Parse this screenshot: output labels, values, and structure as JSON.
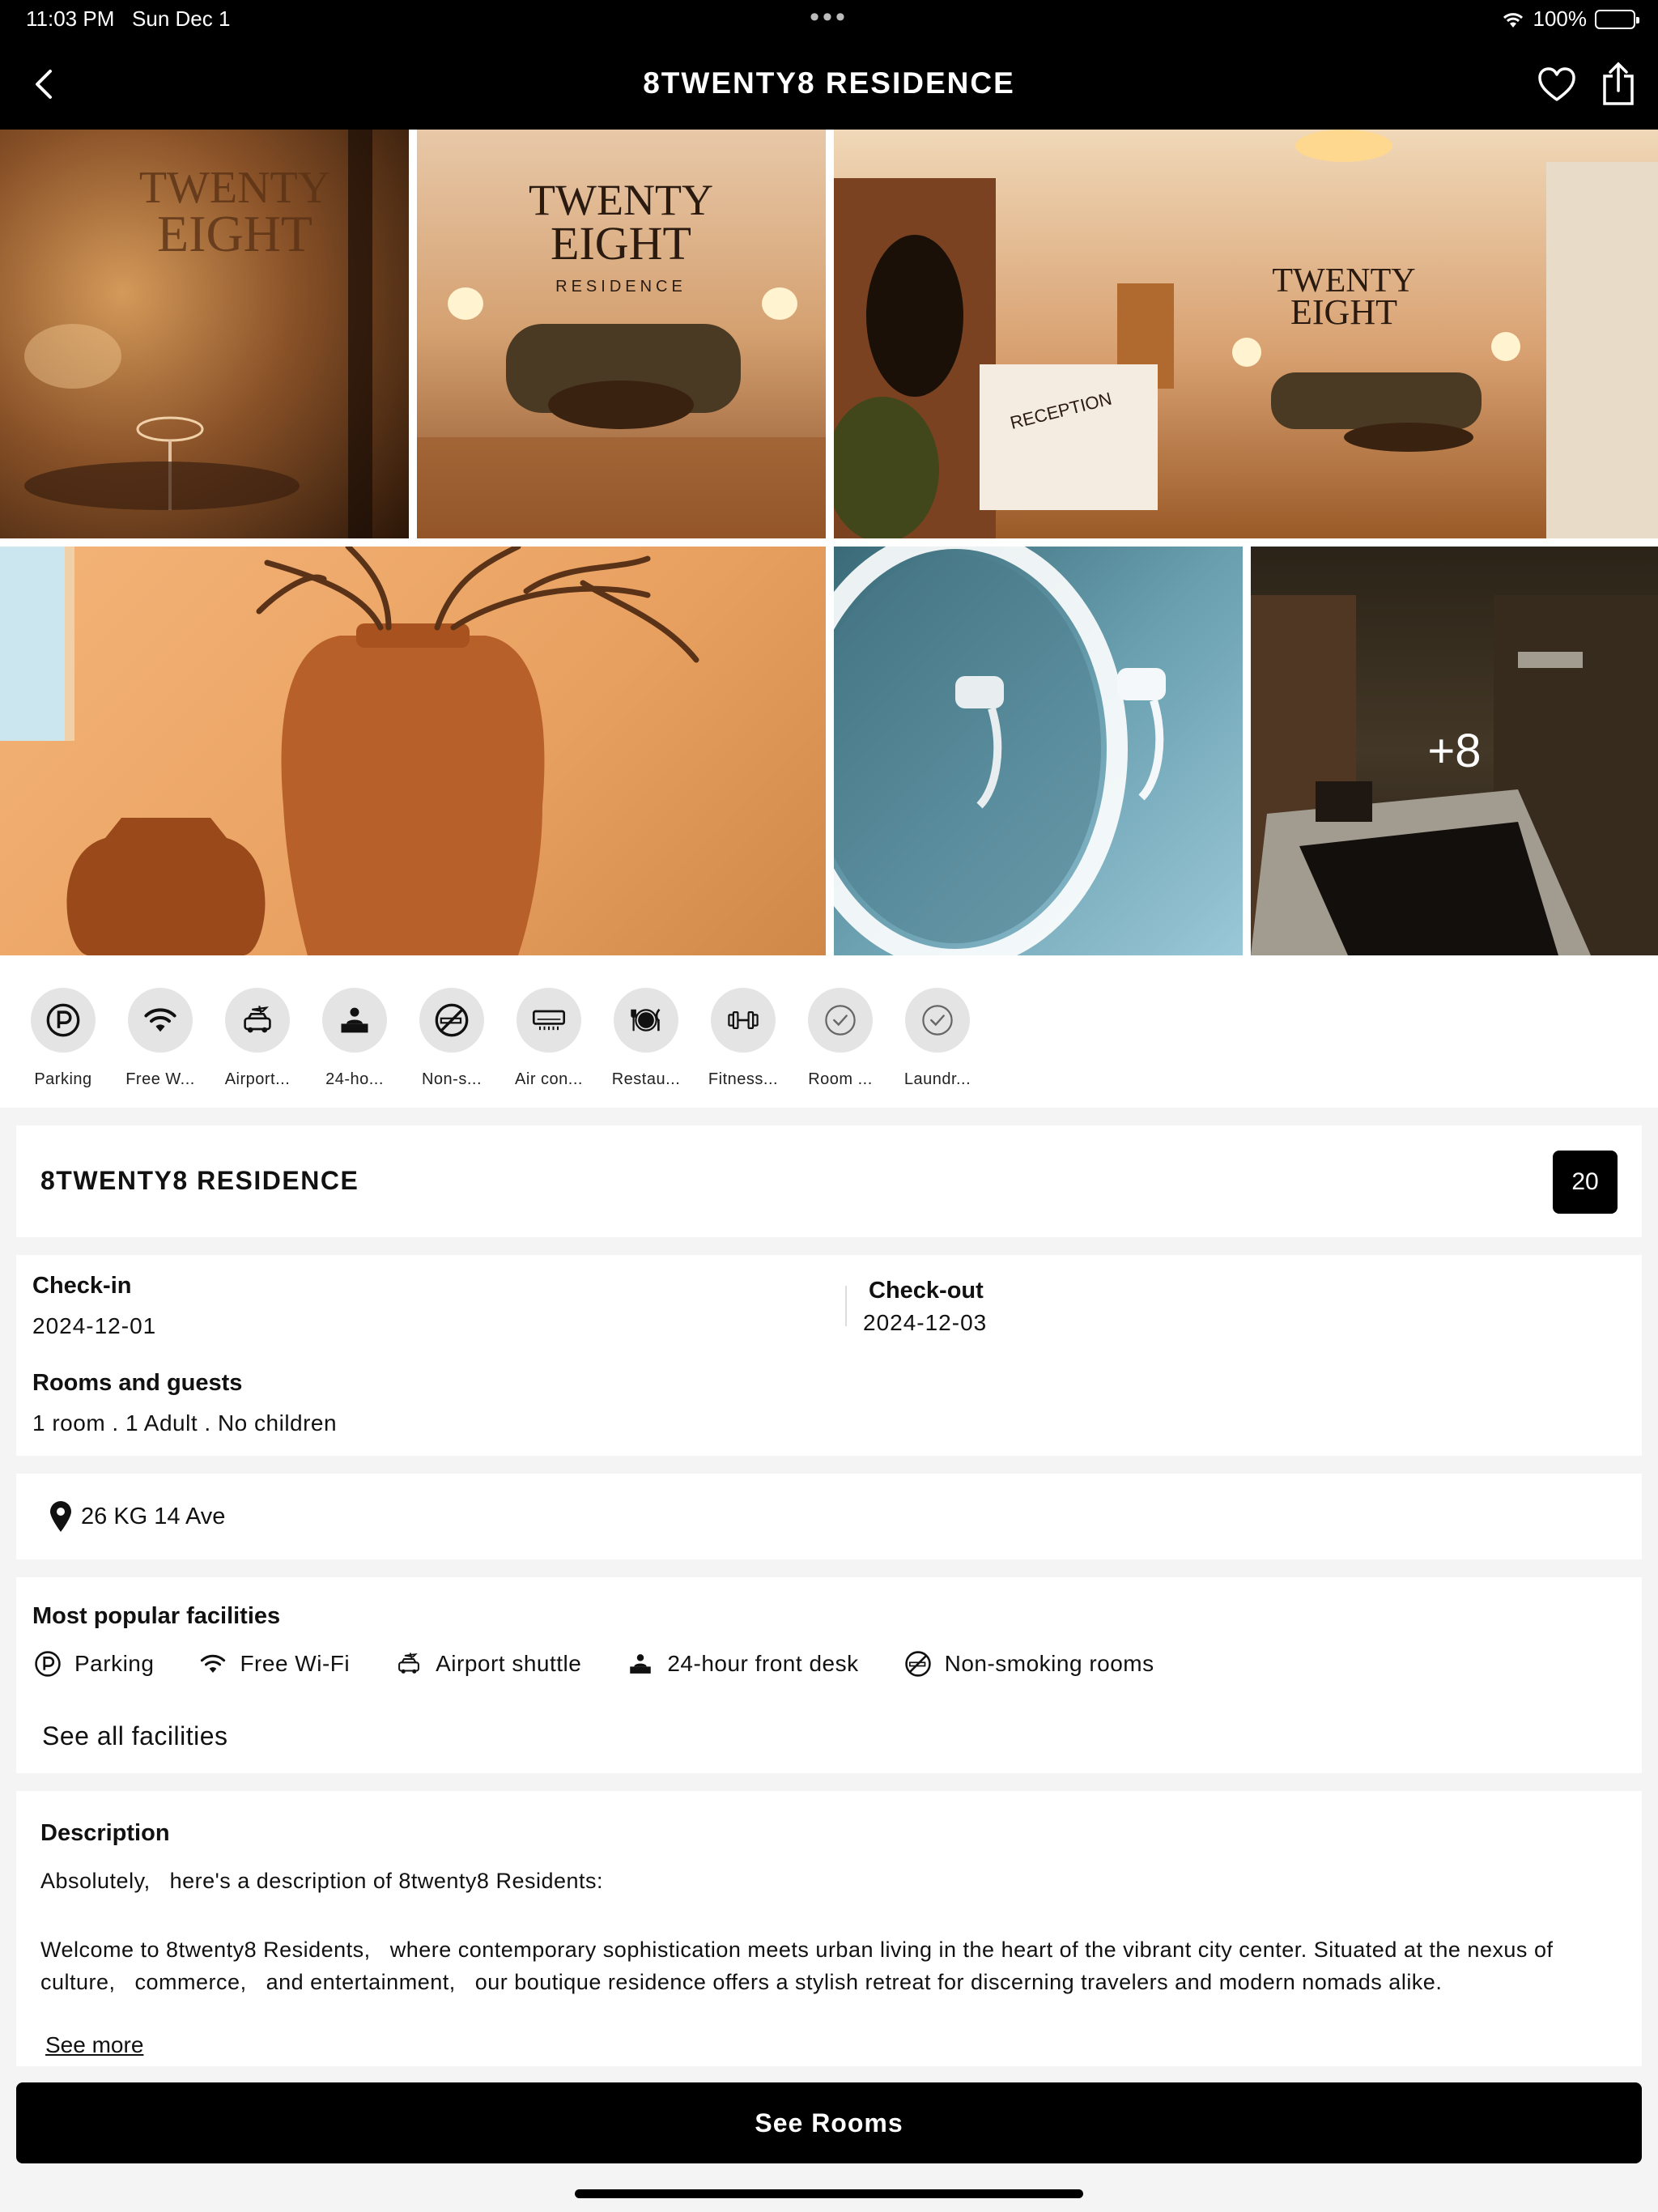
{
  "status": {
    "time": "11:03 PM",
    "date": "Sun Dec 1",
    "battery": "100%"
  },
  "nav": {
    "title": "8TWENTY8 RESIDENCE"
  },
  "gallery": {
    "more_label": "+8"
  },
  "icon_strip": [
    {
      "label": "Parking",
      "icon": "parking-icon"
    },
    {
      "label": "Free W...",
      "icon": "wifi-icon"
    },
    {
      "label": "Airport...",
      "icon": "shuttle-icon"
    },
    {
      "label": "24-ho...",
      "icon": "front-desk-icon"
    },
    {
      "label": "Non-s...",
      "icon": "no-smoking-icon"
    },
    {
      "label": "Air con...",
      "icon": "air-conditioner-icon"
    },
    {
      "label": "Restau...",
      "icon": "restaurant-icon"
    },
    {
      "label": "Fitness...",
      "icon": "dumbbell-icon"
    },
    {
      "label": "Room ...",
      "icon": "check-circle-icon"
    },
    {
      "label": "Laundr...",
      "icon": "check-circle-icon"
    }
  ],
  "hotel": {
    "name": "8TWENTY8 RESIDENCE",
    "score": "20"
  },
  "booking": {
    "checkin_label": "Check-in",
    "checkin_value": "2024-12-01",
    "checkout_label": "Check-out",
    "checkout_value": "2024-12-03",
    "rooms_label": "Rooms and guests",
    "rooms_value": "1 room . 1 Adult . No children"
  },
  "address": "26 KG 14 Ave",
  "popular": {
    "title": "Most popular facilities",
    "items": [
      {
        "label": "Parking",
        "icon": "parking-icon"
      },
      {
        "label": "Free Wi-Fi",
        "icon": "wifi-icon"
      },
      {
        "label": "Airport shuttle",
        "icon": "shuttle-icon"
      },
      {
        "label": "24-hour front desk",
        "icon": "front-desk-icon"
      },
      {
        "label": "Non-smoking rooms",
        "icon": "no-smoking-icon"
      }
    ],
    "see_all": "See all facilities"
  },
  "description": {
    "title": "Description",
    "intro": "Absolutely,   here's a description of 8twenty8 Residents:",
    "body": "Welcome to 8twenty8 Residents,   where contemporary sophistication meets urban living in the heart of the vibrant city center. Situated at the nexus of culture,   commerce,   and entertainment,   our boutique residence offers a stylish retreat for discerning travelers and modern nomads alike.",
    "see_more": "See more"
  },
  "cta": "See Rooms"
}
